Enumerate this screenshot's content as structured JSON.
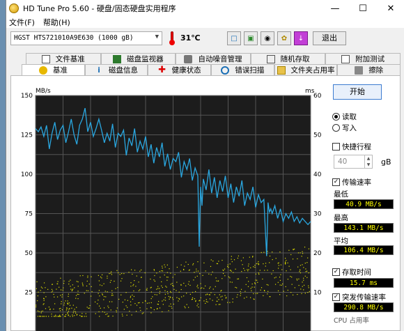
{
  "window": {
    "title": "HD Tune Pro 5.60 - 硬盘/固态硬盘实用程序"
  },
  "menu": [
    "文件(F)",
    "帮助(H)"
  ],
  "toolbar": {
    "drive": "HGST HTS721010A9E630 (1000 gB)",
    "temperature": "31℃",
    "exit_label": "退出"
  },
  "tabs_top": [
    {
      "label": "文件基准",
      "icon": "file-benchmark-icon"
    },
    {
      "label": "磁盘监视器",
      "icon": "disk-monitor-icon"
    },
    {
      "label": "自动噪音管理",
      "icon": "speaker-icon"
    },
    {
      "label": "随机存取",
      "icon": "random-access-icon"
    },
    {
      "label": "附加测试",
      "icon": "extra-tests-icon"
    }
  ],
  "tabs_bottom": [
    {
      "label": "基准",
      "icon": "benchmark-icon",
      "active": true
    },
    {
      "label": "磁盘信息",
      "icon": "info-icon"
    },
    {
      "label": "健康状态",
      "icon": "health-cross-icon"
    },
    {
      "label": "错误扫描",
      "icon": "magnifier-icon"
    },
    {
      "label": "文件夹占用率",
      "icon": "folder-icon"
    },
    {
      "label": "擦除",
      "icon": "trash-icon"
    }
  ],
  "side": {
    "start_label": "开始",
    "read_label": "读取",
    "write_label": "写入",
    "quick_label": "快捷行程",
    "quick_value": "40",
    "quick_unit": "gB",
    "transfer_label": "传输速率",
    "min_label": "最低",
    "min_value": "40.9 MB/s",
    "max_label": "最高",
    "max_value": "143.1 MB/s",
    "avg_label": "平均",
    "avg_value": "106.4 MB/s",
    "access_label": "存取时间",
    "access_value": "15.7 ms",
    "burst_label": "突发传输速率",
    "burst_value": "290.8 MB/s",
    "cpu_label": "CPU 占用率"
  },
  "chart_data": {
    "type": "line",
    "left_unit": "MB/s",
    "right_unit": "ms",
    "y_left_ticks": [
      150,
      125,
      100,
      75,
      50,
      25
    ],
    "y_right_ticks": [
      60,
      50,
      40,
      30,
      20,
      10
    ],
    "ylim_left": [
      0,
      150
    ],
    "ylim_right": [
      0,
      60
    ],
    "xlim": [
      0,
      100
    ],
    "transfer_color": "#2aa7e0",
    "access_color": "#e0e000",
    "transfer_series": {
      "name": "",
      "x": [
        0,
        1,
        2,
        3,
        4,
        5,
        6,
        7,
        8,
        9,
        10,
        11,
        12,
        13,
        14,
        15,
        16,
        17,
        18,
        19,
        20,
        21,
        22,
        23,
        24,
        25,
        26,
        27,
        28,
        29,
        30,
        31,
        32,
        33,
        34,
        35,
        36,
        37,
        38,
        39,
        40,
        41,
        42,
        43,
        44,
        45,
        46,
        47,
        48,
        49,
        50,
        51,
        52,
        53,
        54,
        55,
        56,
        57,
        58,
        59,
        59.5,
        60,
        60.5,
        61,
        62,
        63,
        64,
        65,
        66,
        67,
        68,
        69,
        70,
        71,
        72,
        73,
        74,
        75,
        76,
        77,
        78,
        79,
        80,
        81,
        82,
        83,
        84,
        84.5,
        85,
        85.5,
        86,
        87,
        88,
        89,
        90,
        91,
        92,
        93,
        94,
        95,
        96,
        97,
        98,
        99,
        100
      ],
      "values": [
        129,
        127,
        130,
        124,
        131,
        116,
        126,
        133,
        122,
        128,
        131,
        120,
        127,
        135,
        125,
        119,
        131,
        135,
        142,
        127,
        133,
        124,
        129,
        135,
        128,
        120,
        126,
        121,
        132,
        117,
        126,
        124,
        128,
        112,
        123,
        118,
        129,
        114,
        121,
        116,
        124,
        111,
        119,
        107,
        117,
        111,
        120,
        105,
        113,
        103,
        110,
        108,
        114,
        98,
        108,
        103,
        110,
        96,
        104,
        99,
        54,
        92,
        80,
        97,
        90,
        103,
        88,
        98,
        85,
        96,
        89,
        99,
        85,
        94,
        82,
        92,
        86,
        96,
        80,
        88,
        84,
        92,
        79,
        87,
        82,
        84,
        48,
        82,
        76,
        78,
        75,
        80,
        72,
        78,
        70,
        75,
        72,
        76,
        70,
        73,
        69,
        72,
        70,
        68,
        70
      ]
    },
    "access_series": {
      "name": "",
      "min_ms": 4,
      "max_ms": 22,
      "trend_start_ms": 7,
      "trend_end_ms": 16
    },
    "grid": true
  }
}
